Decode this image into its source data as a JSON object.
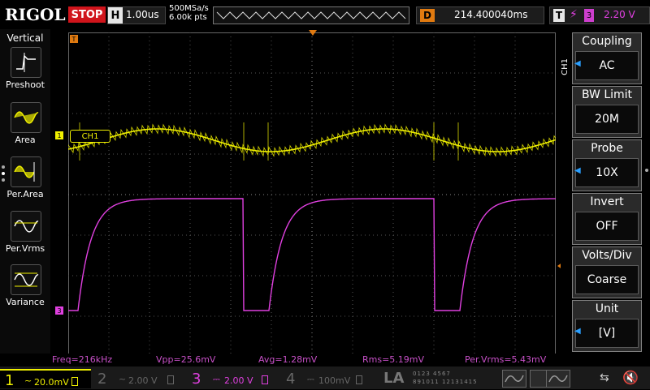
{
  "topbar": {
    "logo": "RIGOL",
    "run_state": "STOP",
    "horizontal_label": "H",
    "timebase": "1.00us",
    "sample_rate": "500MSa/s",
    "memory_depth": "6.00k pts",
    "delay_label": "D",
    "delay_value": "214.400040ms",
    "trigger_label": "T",
    "trigger_source": "3",
    "trigger_level": "2.20 V"
  },
  "left_menu": {
    "title": "Vertical",
    "items": [
      {
        "label": "Preshoot",
        "icon": "preshoot-icon"
      },
      {
        "label": "Area",
        "icon": "area-icon"
      },
      {
        "label": "Per.Area",
        "icon": "period-area-icon"
      },
      {
        "label": "Per.Vrms",
        "icon": "period-vrms-icon"
      },
      {
        "label": "Variance",
        "icon": "variance-icon"
      }
    ]
  },
  "screen": {
    "ch1_label": "CH1",
    "ch1_marker": "1",
    "ch3_marker": "3",
    "trigger_marker": "T"
  },
  "right_menu": {
    "channel_tag": "CH1",
    "items": [
      {
        "title": "Coupling",
        "value": "AC"
      },
      {
        "title": "BW Limit",
        "value": "20M"
      },
      {
        "title": "Probe",
        "value": "10X"
      },
      {
        "title": "Invert",
        "value": "OFF"
      },
      {
        "title": "Volts/Div",
        "value": "Coarse"
      },
      {
        "title": "Unit",
        "value": "[V]"
      }
    ]
  },
  "measurements": {
    "freq": "Freq=216kHz",
    "vpp": "Vpp=25.6mV",
    "avg": "Avg=1.28mV",
    "rms": "Rms=5.19mV",
    "per_vrms": "Per.Vrms=5.43mV"
  },
  "bottombar": {
    "ch1_num": "1",
    "ch1_scale": "20.0mV",
    "ch2_num": "2",
    "ch2_scale": "2.00 V",
    "ch3_num": "3",
    "ch3_scale": "2.00 V",
    "ch4_num": "4",
    "ch4_scale": "100mV",
    "la_label": "LA",
    "digital_row1": "0123 4567",
    "digital_row2": "891011 12131415"
  },
  "colors": {
    "ch1": "#f0f000",
    "ch2": "#00e0ff",
    "ch3": "#e040e0",
    "ch4": "#2080ff",
    "accent": "#e07a10"
  }
}
